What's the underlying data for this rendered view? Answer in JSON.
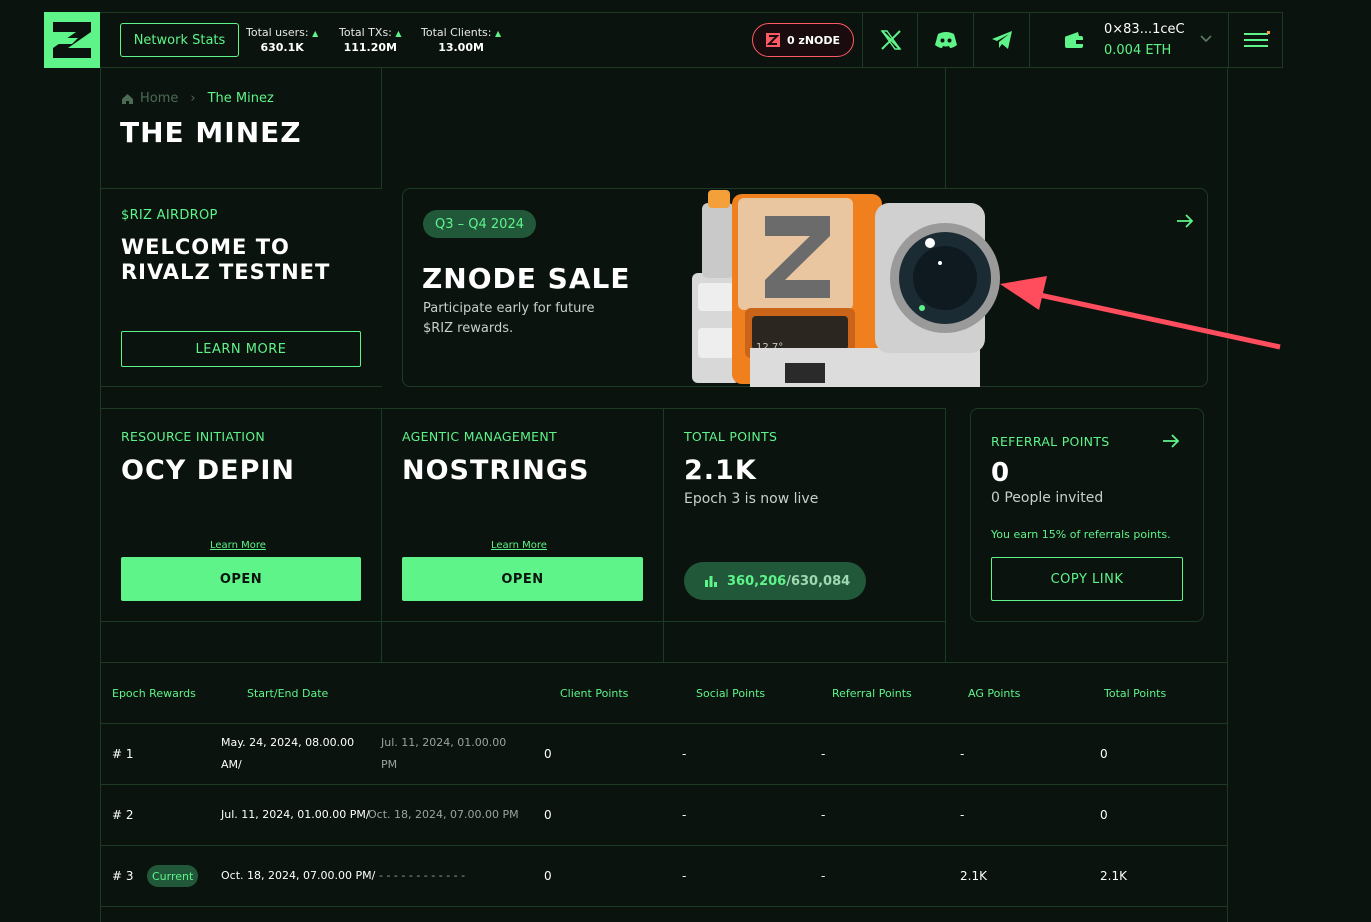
{
  "header": {
    "network_stats_label": "Network Stats",
    "stats": [
      {
        "label": "Total users:",
        "value": "630.1K"
      },
      {
        "label": "Total TXs:",
        "value": "111.20M"
      },
      {
        "label": "Total Clients:",
        "value": "13.00M"
      }
    ],
    "znode_label": "0 zNODE",
    "wallet_address": "0×83...1ceC",
    "wallet_balance": "0.004 ETH",
    "icons": [
      "x-icon",
      "discord-icon",
      "telegram-icon",
      "wallet-icon",
      "menu-icon"
    ]
  },
  "breadcrumb": {
    "home": "Home",
    "current": "The Minez"
  },
  "page_title": "THE MINEZ",
  "airdrop": {
    "label": "$RIZ AIRDROP",
    "title_line1": "WELCOME TO",
    "title_line2": "RIVALZ TESTNET",
    "button": "LEARN MORE"
  },
  "znode_sale": {
    "badge": "Q3 – Q4 2024",
    "title": "ZNODE SALE",
    "desc_line1": "Participate early for future",
    "desc_line2": "$RIZ rewards.",
    "device_display": "12.7°"
  },
  "resource": {
    "label": "RESOURCE INITIATION",
    "title": "OCY DEPIN",
    "link": "Learn More",
    "button": "OPEN"
  },
  "agentic": {
    "label": "AGENTIC MANAGEMENT",
    "title": "NOSTRINGS",
    "link": "Learn More",
    "button": "OPEN"
  },
  "total_points": {
    "label": "TOTAL POINTS",
    "value": "2.1K",
    "sub": "Epoch 3 is now live",
    "rank": "360,206",
    "rank_total": "/630,084"
  },
  "referral": {
    "label": "REFERRAL POINTS",
    "value": "0",
    "invited": "0 People invited",
    "note": "You earn 15% of referrals points.",
    "button": "COPY LINK"
  },
  "table": {
    "headers": [
      "Epoch Rewards",
      "Start/End Date",
      "Client Points",
      "Social Points",
      "Referral Points",
      "AG Points",
      "Total Points"
    ],
    "rows": [
      {
        "epoch": "# 1",
        "badge": "",
        "start_a": "May. 24, 2024, 08.00.00",
        "start_b": "AM/",
        "end_a": "Jul. 11, 2024, 01.00.00",
        "end_b": "PM",
        "client": "0",
        "social": "-",
        "referral": "-",
        "ag": "-",
        "total": "0"
      },
      {
        "epoch": "# 2",
        "badge": "",
        "start_a": "Jul. 11, 2024, 01.00.00 PM/",
        "start_b": "",
        "end_a": "Oct. 18, 2024, 07.00.00 PM",
        "end_b": "",
        "client": "0",
        "social": "-",
        "referral": "-",
        "ag": "-",
        "total": "0"
      },
      {
        "epoch": "# 3",
        "badge": "Current",
        "start_a": "Oct. 18, 2024, 07.00.00 PM/",
        "start_b": "",
        "end_a": "- - - - - - - - - - - -",
        "end_b": "",
        "client": "0",
        "social": "-",
        "referral": "-",
        "ag": "2.1K",
        "total": "2.1K"
      }
    ]
  },
  "colors": {
    "accent": "#5ff48a",
    "background": "#0a130d",
    "annotation_arrow": "#ff4d5e"
  }
}
